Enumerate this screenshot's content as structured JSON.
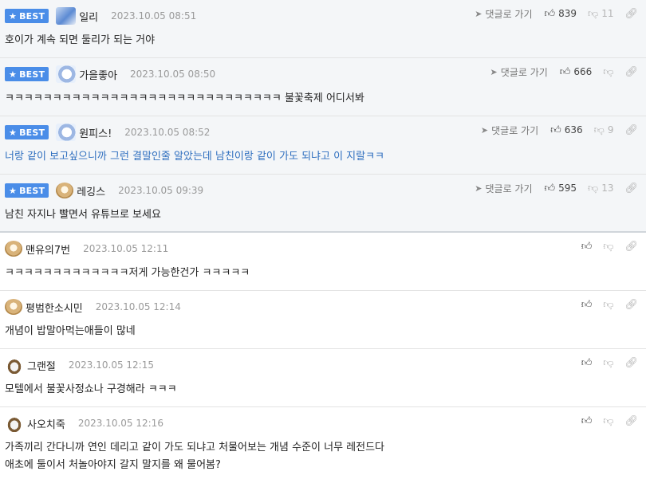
{
  "comments": [
    {
      "best": true,
      "badge": "BEST",
      "nick": "일리",
      "date": "2023.10.05 08:51",
      "text": "호이가 계속 되면 둘리가 되는 거야",
      "reply": "댓글로 가기",
      "up": "839",
      "down": "11"
    },
    {
      "best": true,
      "badge": "BEST",
      "nick": "가을좋아",
      "date": "2023.10.05 08:50",
      "text": "ㅋㅋㅋㅋㅋㅋㅋㅋㅋㅋㅋㅋㅋㅋㅋㅋㅋㅋㅋㅋㅋㅋㅋㅋㅋㅋㅋㅋㅋ 불꽃축제 어디서봐",
      "reply": "댓글로 가기",
      "up": "666",
      "down": ""
    },
    {
      "best": true,
      "badge": "BEST",
      "nick": "원피스!",
      "date": "2023.10.05 08:52",
      "text": "너랑 같이 보고싶으니까 그런 결말인줄 알았는데 남친이랑 같이 가도 되냐고 이 지랄ㅋㅋ",
      "reply": "댓글로 가기",
      "up": "636",
      "down": "9"
    },
    {
      "best": true,
      "badge": "BEST",
      "nick": "레깅스",
      "date": "2023.10.05 09:39",
      "text": "남친 자지나 빨면서 유튜브로 보세요",
      "reply": "댓글로 가기",
      "up": "595",
      "down": "13"
    },
    {
      "best": false,
      "nick": "맨유의7번",
      "date": "2023.10.05 12:11",
      "text": "ㅋㅋㅋㅋㅋㅋㅋㅋㅋㅋㅋㅋㅋ저게 가능한건가 ㅋㅋㅋㅋㅋ"
    },
    {
      "best": false,
      "nick": "평범한소시민",
      "date": "2023.10.05 12:14",
      "text": "개념이 밥말아먹는애들이 많네"
    },
    {
      "best": false,
      "nick": "그랜절",
      "date": "2023.10.05 12:15",
      "text": "모텔에서 불꽃사정쇼나 구경해라 ㅋㅋㅋ"
    },
    {
      "best": false,
      "nick": "사오치죽",
      "date": "2023.10.05 12:16",
      "text": "가족끼리 간다니까 연인 데리고 같이 가도 되냐고 처물어보는 개념 수준이 너무 레전드다",
      "text2": "애초에 둘이서 처놀아야지 갈지 말지를 왜 물어봄?"
    }
  ],
  "icons": {
    "reply": "reply-arrow-icon",
    "up": "thumbs-up-icon",
    "down": "thumbs-down-icon",
    "link": "link-icon",
    "star": "star-icon"
  }
}
